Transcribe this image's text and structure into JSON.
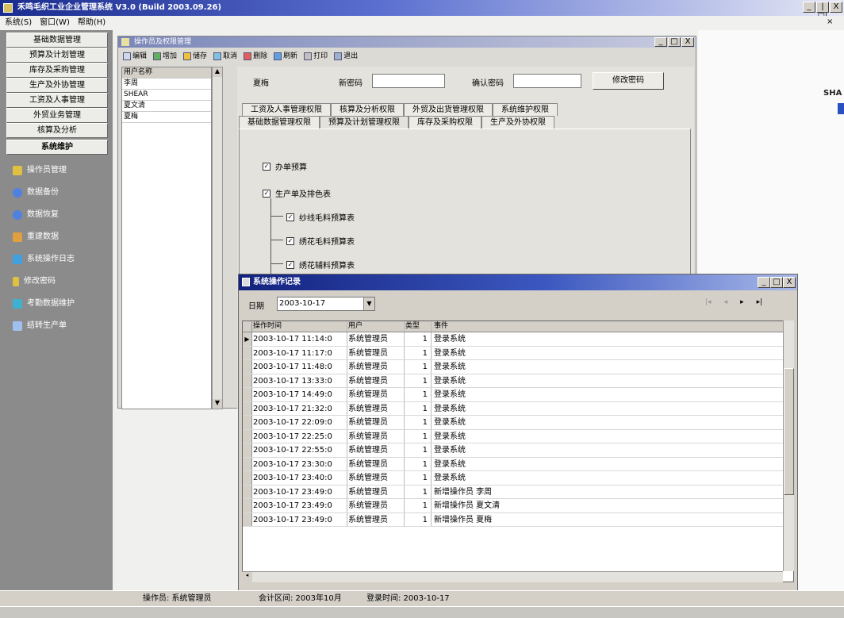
{
  "app": {
    "title": "禾鸣毛织工业企业管理系统 V3.0 (Build 2003.09.26)",
    "controls": [
      "_",
      "|□|",
      "X"
    ]
  },
  "menu": [
    "系统(S)",
    "窗口(W)",
    "帮助(H)"
  ],
  "sidebar": {
    "buttons": [
      "基础数据管理",
      "预算及计划管理",
      "库存及采购管理",
      "生产及外协管理",
      "工资及人事管理",
      "外贸业务管理",
      "核算及分析",
      "系统维护"
    ],
    "items": [
      {
        "label": "操作员管理",
        "icon": "users-icon",
        "color": "#e0c040"
      },
      {
        "label": "数据备份",
        "icon": "backup-icon",
        "color": "#5080e0"
      },
      {
        "label": "数据恢复",
        "icon": "restore-icon",
        "color": "#5080e0"
      },
      {
        "label": "重建数据",
        "icon": "rebuild-icon",
        "color": "#e0a040"
      },
      {
        "label": "系统操作日志",
        "icon": "log-icon",
        "color": "#40a0e0"
      },
      {
        "label": "修改密码",
        "icon": "key-icon",
        "color": "#e0c040"
      },
      {
        "label": "考勤数据维护",
        "icon": "clock-icon",
        "color": "#40b0d0"
      },
      {
        "label": "结转生产单",
        "icon": "transfer-icon",
        "color": "#a0c0f0"
      }
    ]
  },
  "right_pane": {
    "text": "SHA"
  },
  "win1": {
    "title": "操作员及权限管理",
    "controls": [
      "_",
      "□",
      "X"
    ],
    "toolbar": [
      "编辑",
      "增加",
      "储存",
      "取消",
      "删除",
      "刷新",
      "打印",
      "退出"
    ],
    "user_list_header": "用户名称",
    "users": [
      "李周",
      "SHEAR",
      "夏文清",
      "夏梅"
    ],
    "current_user": "夏梅",
    "new_password_label": "新密码",
    "confirm_password_label": "确认密码",
    "change_password_button": "修改密码",
    "tabs_row1": [
      "工资及人事管理权限",
      "核算及分析权限",
      "外贸及出货管理权限",
      "系统维护权限"
    ],
    "tabs_row2": [
      "基础数据管理权限",
      "预算及计划管理权限",
      "库存及采购权限",
      "生产及外协权限"
    ],
    "checks": [
      "办单预算",
      "生产单及排色表",
      "纱线毛料预算表",
      "绣花毛料预算表",
      "绣花辅料预算表"
    ]
  },
  "win2": {
    "title": "系统操作记录",
    "controls": [
      "_",
      "□",
      "X"
    ],
    "date_label": "日期",
    "date_value": "2003-10-17",
    "nav": [
      "|◂",
      "◂",
      "▸",
      "▸|"
    ],
    "columns": [
      "操作时间",
      "用户",
      "类型",
      "事件"
    ],
    "rows": [
      {
        "time": "2003-10-17 11:14:0",
        "user": "系统管理员",
        "type": "1",
        "event": "登录系统"
      },
      {
        "time": "2003-10-17 11:17:0",
        "user": "系统管理员",
        "type": "1",
        "event": "登录系统"
      },
      {
        "time": "2003-10-17 11:48:0",
        "user": "系统管理员",
        "type": "1",
        "event": "登录系统"
      },
      {
        "time": "2003-10-17 13:33:0",
        "user": "系统管理员",
        "type": "1",
        "event": "登录系统"
      },
      {
        "time": "2003-10-17 14:49:0",
        "user": "系统管理员",
        "type": "1",
        "event": "登录系统"
      },
      {
        "time": "2003-10-17 21:32:0",
        "user": "系统管理员",
        "type": "1",
        "event": "登录系统"
      },
      {
        "time": "2003-10-17 22:09:0",
        "user": "系统管理员",
        "type": "1",
        "event": "登录系统"
      },
      {
        "time": "2003-10-17 22:25:0",
        "user": "系统管理员",
        "type": "1",
        "event": "登录系统"
      },
      {
        "time": "2003-10-17 22:55:0",
        "user": "系统管理员",
        "type": "1",
        "event": "登录系统"
      },
      {
        "time": "2003-10-17 23:30:0",
        "user": "系统管理员",
        "type": "1",
        "event": "登录系统"
      },
      {
        "time": "2003-10-17 23:40:0",
        "user": "系统管理员",
        "type": "1",
        "event": "登录系统"
      },
      {
        "time": "2003-10-17 23:49:0",
        "user": "系统管理员",
        "type": "1",
        "event": "新增操作员 李周"
      },
      {
        "time": "2003-10-17 23:49:0",
        "user": "系统管理员",
        "type": "1",
        "event": "新增操作员 夏文清"
      },
      {
        "time": "2003-10-17 23:49:0",
        "user": "系统管理员",
        "type": "1",
        "event": "新增操作员 夏梅"
      }
    ]
  },
  "status": {
    "operator": "操作员: 系统管理员",
    "period": "会计区间: 2003年10月",
    "login_time": "登录时间: 2003-10-17"
  }
}
